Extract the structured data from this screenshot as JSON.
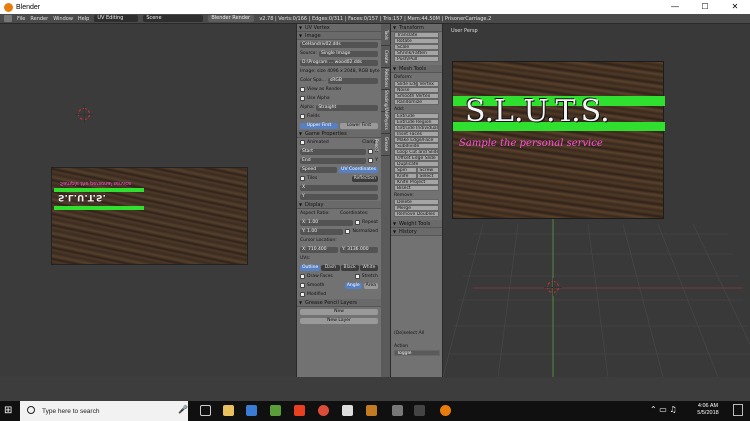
{
  "window": {
    "title": "Blender",
    "minimize": "—",
    "maximize": "☐",
    "close": "✕"
  },
  "menu": {
    "items": [
      "File",
      "Render",
      "Window",
      "Help"
    ]
  },
  "header": {
    "layout": "UV Editing",
    "scene": "Scene",
    "engine": "Blender Render",
    "stats": "v2.78 | Verts:0/166 | Edges:0/311 | Faces:0/157 | Tris:157 | Mem:44.50M | PrisonerCarriage.2"
  },
  "uv_panel": {
    "vertex_title": "UV Vertex",
    "image_title": "Image",
    "image_name": "CeHandriv02.dds",
    "source_label": "Source:",
    "source_value": "Single Image",
    "filepath": "D:\\Program ... wood02.dds",
    "image_info": "Image: size 4096 x 2048, RGB byte",
    "colorspace_label": "Color Spa...",
    "colorspace_value": "sRGB",
    "view_as_render": "View as Render",
    "use_alpha": "Use Alpha",
    "alpha_label": "Alpha:",
    "alpha_value": "Straight",
    "fields": "Fields",
    "upper_first": "Upper First",
    "lower_first": "Lower First",
    "game_props_title": "Game Properties",
    "animated": "Animated",
    "clamp": "Clamp:",
    "start": "Start",
    "end": "End",
    "speed": "Speed",
    "clamp_x": "X",
    "clamp_y": "Y",
    "tiles": "Tiles",
    "uv_coordinates": "UV Coordinates",
    "reflection": "Reflection",
    "tiles_x": "X",
    "tiles_y": "Y",
    "display_title": "Display",
    "aspect_ratio": "Aspect Ratio:",
    "coordinates": "Coordinates:",
    "aspect_x": "X:",
    "aspect_x_val": "1.00",
    "aspect_y": "Y:",
    "aspect_y_val": "1.00",
    "repeat": "Repeat",
    "normalized": "Normalized",
    "cursor_location": "Cursor Location:",
    "cursor_x": "X: 710.400",
    "cursor_y": "Y: 3136.000",
    "uvs": "UVs:",
    "uv_modes": [
      "Outline",
      "Dash",
      "Black",
      "White"
    ],
    "draw_faces": "Draw Faces",
    "stretch": "Stretch",
    "smooth": "Smooth",
    "angle": "Angle",
    "area": "Area",
    "modified": "Modified",
    "grease_title": "Grease Pencil Layers",
    "new": "New",
    "new_layer": "New Layer"
  },
  "vertical_tabs": [
    "Tools",
    "Create",
    "Relations",
    "Shading/UVs",
    "Physics",
    "Grease Pencil"
  ],
  "tool_shelf": {
    "transform_title": "Transform",
    "transform": [
      "Translate",
      "Rotate",
      "Scale",
      "Shrink/Fatten",
      "Push/Pull"
    ],
    "mesh_tools_title": "Mesh Tools",
    "deform_label": "Deform:",
    "slide_edge": "Slide Edge",
    "vertex": "Vertex",
    "deform": [
      "Noise",
      "Smooth Vertex",
      "Randomize"
    ],
    "add_label": "Add:",
    "extrude": "Extrude",
    "add": [
      "Extrude Region",
      "Extrude Individual",
      "Inset Faces",
      "Make Edge/Face",
      "Subdivide",
      "Loop Cut and Slide",
      "Offset Edge Slide",
      "Duplicate"
    ],
    "spin": "Spin",
    "screw": "Screw",
    "knife": "Knife",
    "select": "Select",
    "add2": [
      "Knife Project",
      "Bisect"
    ],
    "remove_label": "Remove:",
    "delete": "Delete",
    "merge": "Merge",
    "remove_doubles": "Remove Doubles",
    "weight_tools": "Weight Tools",
    "history": "History",
    "deselect_all": "(De)select All",
    "action_label": "Action",
    "action_value": "Toggle"
  },
  "viewport": {
    "view_label": "User Persp",
    "sign_text": "S.L.U.T.S.",
    "sign_tagline": "Sample the personal service"
  },
  "uv_image": {
    "sign_text": "S.L.U.T.S.",
    "sign_tagline": "Sample the personal service"
  },
  "taskbar": {
    "search_placeholder": "Type here to search",
    "time": "4:06 AM",
    "date": "5/5/2018"
  },
  "colors": {
    "accent_green": "#2fe02f",
    "tagline_pink": "#ff4fd8",
    "uv_active_blue": "#5680c2"
  }
}
